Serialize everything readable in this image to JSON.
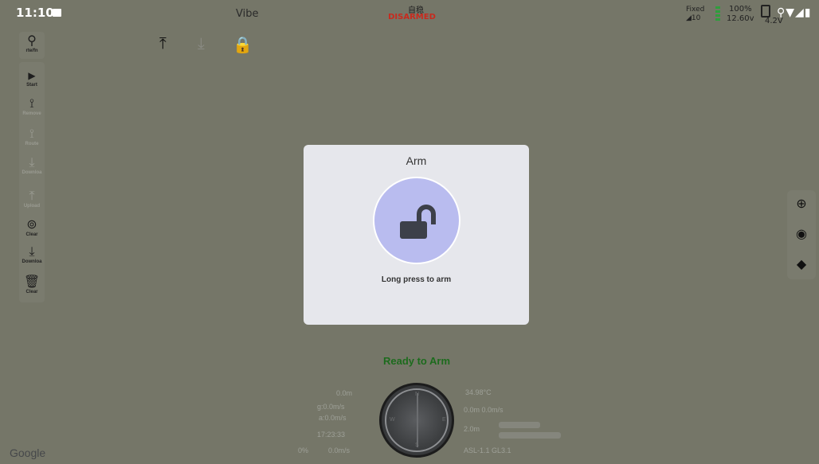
{
  "status_bar": {
    "time": "11:10",
    "title": "Vibe",
    "flight_mode": "自稳",
    "arm_state": "DISARMED",
    "gps_fix": "Fixed",
    "gps_count": "◢10",
    "battery_percent": "100%",
    "battery_voltage": "12.60v",
    "rc_voltage": "4.2V",
    "system_icons": "⚲▼◢▮"
  },
  "left_toolbar": {
    "top_item": {
      "label": "rte/fn",
      "icon": "route-nodes-icon"
    },
    "items": [
      {
        "label": "Start",
        "icon": "play-icon"
      },
      {
        "label": "Remove",
        "icon": "remove-route-icon"
      },
      {
        "label": "Route",
        "icon": "route-icon"
      },
      {
        "label": "Downloa",
        "icon": "download-icon"
      },
      {
        "label": "Upload",
        "icon": "upload-icon"
      },
      {
        "label": "Clear",
        "icon": "clear-point-icon"
      },
      {
        "label": "Downloa",
        "icon": "download-icon"
      },
      {
        "label": "Clear",
        "icon": "trash-icon"
      }
    ]
  },
  "dialog": {
    "title": "Arm",
    "hint": "Long press to arm"
  },
  "hud": {
    "ready_text": "Ready to Arm",
    "altitude": "0.0m",
    "ground_speed": "g:0.0m/s",
    "air_speed": "a:0.0m/s",
    "time": "17:23:33",
    "throttle": "0%",
    "climb_rate": "0.0m/s",
    "temperature": "34.98°C",
    "distance_speed": "0.0m 0.0m/s",
    "home_dist": "2.0m",
    "alt_readout": "ASL-1.1 GL3.1",
    "compass_n": "N",
    "compass_s": "S",
    "compass_w": "W",
    "compass_e": "E"
  },
  "map": {
    "attribution": "Google"
  }
}
